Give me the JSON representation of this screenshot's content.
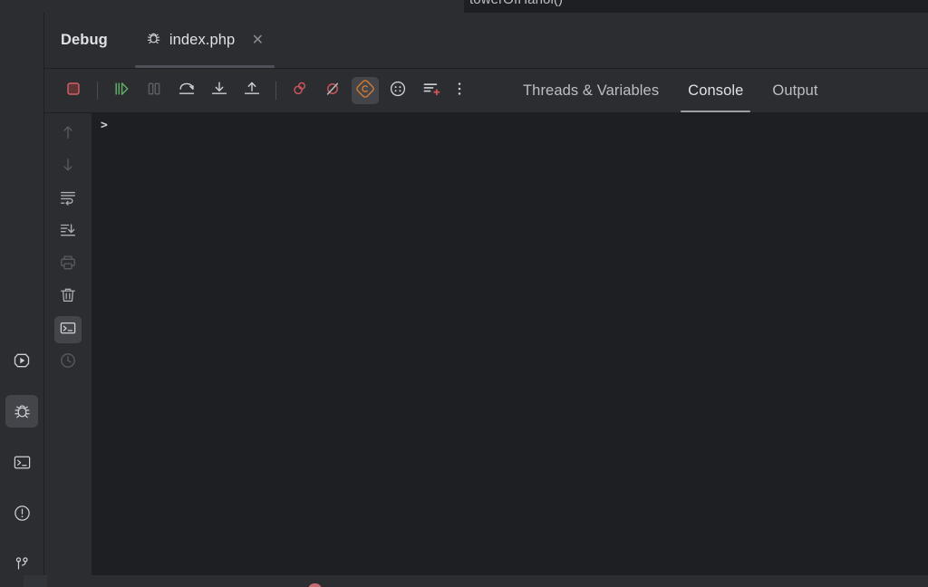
{
  "editor_sliver": {
    "clipped_code_text": "towerOfHanoi()"
  },
  "tool_window_bar": {
    "items": [
      {
        "name": "run",
        "label": "Run",
        "icon": "run-hexagon-icon",
        "active": false
      },
      {
        "name": "debug",
        "label": "Debug",
        "icon": "bug-icon",
        "active": true
      },
      {
        "name": "terminal",
        "label": "Terminal",
        "icon": "terminal-icon",
        "active": false
      },
      {
        "name": "problems",
        "label": "Problems",
        "icon": "exclamation-circle-icon",
        "active": false
      },
      {
        "name": "version-control",
        "label": "Version Control",
        "icon": "git-branch-icon",
        "active": false
      }
    ]
  },
  "debug_window": {
    "title": "Debug",
    "session_tab": {
      "label": "index.php",
      "icon": "bug-icon",
      "close_glyph": "✕",
      "selected": true
    },
    "toolbar": {
      "buttons": [
        {
          "name": "stop",
          "label": "Stop",
          "icon": "stop-square-icon",
          "state": "normal",
          "color": "#c9555a"
        },
        {
          "name": "resume",
          "label": "Resume Program",
          "icon": "resume-icon",
          "state": "normal",
          "color": "#5fad65"
        },
        {
          "name": "pause",
          "label": "Pause Program",
          "icon": "pause-icon",
          "state": "disabled"
        },
        {
          "name": "step-over",
          "label": "Step Over",
          "icon": "step-over-icon",
          "state": "normal"
        },
        {
          "name": "step-into",
          "label": "Step Into",
          "icon": "step-into-icon",
          "state": "normal"
        },
        {
          "name": "step-out",
          "label": "Step Out",
          "icon": "step-out-icon",
          "state": "normal"
        },
        {
          "name": "view-breakpoints",
          "label": "View Breakpoints",
          "icon": "breakpoints-icon",
          "state": "normal",
          "color": "#c9555a"
        },
        {
          "name": "mute-breakpoints",
          "label": "Mute Breakpoints",
          "icon": "mute-breakpoints-icon",
          "state": "normal",
          "color": "#c9555a"
        },
        {
          "name": "listen-php-debug",
          "label": "Start Listening for PHP Debug Connections",
          "icon": "php-listen-diamond-icon",
          "state": "active",
          "color": "#cc7832"
        },
        {
          "name": "settings-dots",
          "label": "Settings",
          "icon": "dots-circle-icon",
          "state": "normal"
        },
        {
          "name": "add-to-watches",
          "label": "Add to Watches",
          "icon": "add-watch-icon",
          "state": "normal",
          "color": "#c9555a"
        },
        {
          "name": "more-options",
          "label": "More Options",
          "icon": "vertical-ellipsis-icon",
          "state": "normal"
        }
      ]
    },
    "view_tabs": [
      {
        "label": "Threads & Variables",
        "selected": false
      },
      {
        "label": "Console",
        "selected": true
      },
      {
        "label": "Output",
        "selected": false
      }
    ],
    "console": {
      "sidebar_buttons": [
        {
          "name": "previous-occurrence",
          "label": "Previous Occurrence",
          "icon": "arrow-up-icon",
          "state": "dim"
        },
        {
          "name": "next-occurrence",
          "label": "Next Occurrence",
          "icon": "arrow-down-icon",
          "state": "dim"
        },
        {
          "name": "soft-wrap",
          "label": "Soft-Wrap",
          "icon": "soft-wrap-icon",
          "state": "normal"
        },
        {
          "name": "scroll-to-end",
          "label": "Scroll to End",
          "icon": "scroll-to-end-icon",
          "state": "normal"
        },
        {
          "name": "print",
          "label": "Print",
          "icon": "printer-icon",
          "state": "dim"
        },
        {
          "name": "clear-all",
          "label": "Clear All",
          "icon": "trash-icon",
          "state": "normal"
        },
        {
          "name": "console-toggle",
          "label": "Console",
          "icon": "terminal-icon",
          "state": "active"
        },
        {
          "name": "history",
          "label": "History",
          "icon": "clock-icon",
          "state": "dim"
        }
      ],
      "prompt_glyph": ">",
      "content": ""
    }
  },
  "colors": {
    "window_background": "#1e1f22",
    "panel_background": "#2b2d30",
    "active_button_background": "#43454a",
    "text_primary": "#dfe1e5",
    "text_secondary": "#bcbec4",
    "accent_red": "#c9555a",
    "accent_green": "#5fad65",
    "accent_orange": "#cc7832"
  }
}
